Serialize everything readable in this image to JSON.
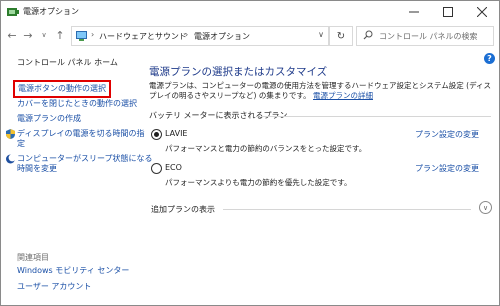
{
  "window": {
    "title": "電源オプション"
  },
  "nav": {
    "breadcrumb": [
      "ハードウェアとサウンド",
      "電源オプション"
    ],
    "search_placeholder": "コントロール パネルの検索"
  },
  "sidebar": {
    "home": "コントロール パネル ホーム",
    "links": [
      "電源ボタンの動作の選択",
      "カバーを閉じたときの動作の選択",
      "電源プランの作成",
      "ディスプレイの電源を切る時間の指",
      "定",
      "コンピューターがスリープ状態になる",
      "時間を変更"
    ],
    "see_also_title": "関連項目",
    "see_also": [
      "Windows モビリティ センター",
      "ユーザー アカウント"
    ]
  },
  "main": {
    "heading": "電源プランの選択またはカスタマイズ",
    "description": "電源プランは、コンピューターの電源の使用方法を管理するハードウェア設定とシステム設定 (ディスプレイの明るさやスリープなど) の集まりです。",
    "description_link": "電源プランの詳細",
    "group_label": "バッテリ メーターに表示されるプラン",
    "plans": [
      {
        "name": "LAVIE",
        "description": "パフォーマンスと電力の節約のバランスをとった設定です。",
        "link": "プラン設定の変更",
        "selected": true
      },
      {
        "name": "ECO",
        "description": "パフォーマンスよりも電力の節約を優先した設定です。",
        "link": "プラン設定の変更",
        "selected": false
      }
    ],
    "extra_plans_label": "追加プランの表示"
  },
  "colors": {
    "link": "#1a4fa6",
    "heading": "#1e3a8a",
    "highlight": "#e00000",
    "help": "#1b6ed3"
  }
}
